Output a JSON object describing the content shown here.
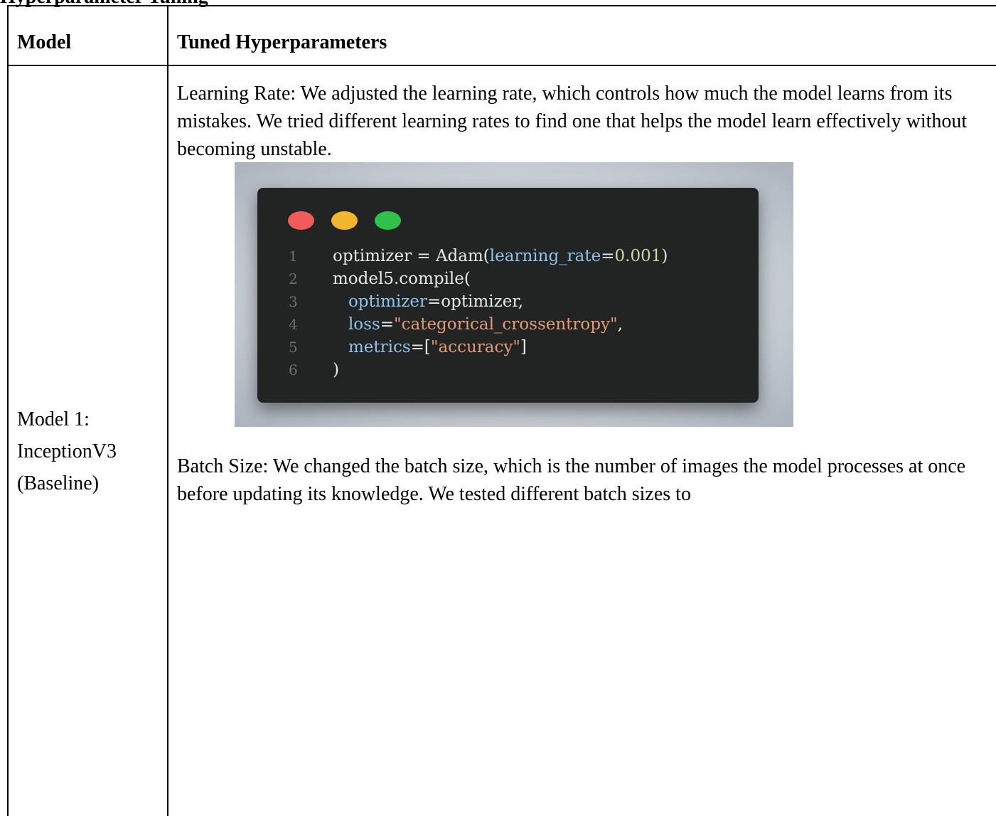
{
  "heading": "Hyperparameter Tuning",
  "table": {
    "headers": {
      "model": "Model",
      "params": "Tuned Hyperparameters"
    },
    "rows": [
      {
        "model_lines": [
          "Model 1:",
          "InceptionV3",
          "(Baseline)"
        ],
        "learning_rate_text": "Learning Rate: We adjusted the learning rate, which controls how much the model learns from its mistakes. We tried different learning rates to find one that helps the model learn effectively without becoming unstable.",
        "batch_size_text": "Batch Size: We changed the batch size, which is the number of images the model processes at once before updating its knowledge. We tested different batch sizes to"
      }
    ]
  },
  "code_snippet": {
    "colors": {
      "background": "#222323",
      "red_dot": "#f25b5b",
      "yellow_dot": "#f4b62e",
      "green_dot": "#2fc14a"
    },
    "lines": [
      {
        "number": "1",
        "tokens": [
          {
            "text": "optimizer = Adam(",
            "kind": "plain"
          },
          {
            "text": "learning_rate",
            "kind": "param"
          },
          {
            "text": "=",
            "kind": "plain"
          },
          {
            "text": "0.001",
            "kind": "num"
          },
          {
            "text": ")",
            "kind": "plain"
          }
        ]
      },
      {
        "number": "2",
        "tokens": [
          {
            "text": "model5.compile(",
            "kind": "plain"
          }
        ]
      },
      {
        "number": "3",
        "tokens": [
          {
            "text": "   ",
            "kind": "plain"
          },
          {
            "text": "optimizer",
            "kind": "param"
          },
          {
            "text": "=optimizer,",
            "kind": "plain"
          }
        ]
      },
      {
        "number": "4",
        "tokens": [
          {
            "text": "   ",
            "kind": "plain"
          },
          {
            "text": "loss",
            "kind": "param"
          },
          {
            "text": "=",
            "kind": "plain"
          },
          {
            "text": "\"categorical_crossentropy\"",
            "kind": "str"
          },
          {
            "text": ",",
            "kind": "plain"
          }
        ]
      },
      {
        "number": "5",
        "tokens": [
          {
            "text": "   ",
            "kind": "plain"
          },
          {
            "text": "metrics",
            "kind": "param"
          },
          {
            "text": "=[",
            "kind": "plain"
          },
          {
            "text": "\"accuracy\"",
            "kind": "str"
          },
          {
            "text": "]",
            "kind": "plain"
          }
        ]
      },
      {
        "number": "6",
        "tokens": [
          {
            "text": ")",
            "kind": "plain"
          }
        ]
      }
    ]
  }
}
